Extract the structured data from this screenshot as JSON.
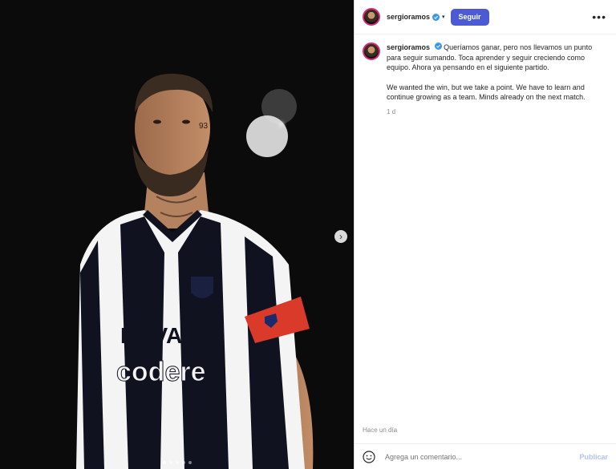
{
  "post": {
    "username": "sergioramos",
    "follow_label": "Seguir",
    "caption_es": "Queríamos ganar, pero nos llevamos un punto para seguir sumando. Toca aprender y seguir creciendo como equipo. Ahora ya pensando en el siguiente partido.",
    "caption_en": "We wanted the win, but we take a point. We have to learn and continue growing as a team. Minds already on the next match.",
    "caption_time": "1 d",
    "date_label": "Hace un día",
    "comment_placeholder": "Agrega un comentario...",
    "publish_label": "Publicar",
    "carousel": {
      "total": 5,
      "active": 1
    },
    "jersey_text": {
      "sponsor": "BBVA",
      "secondary": "codere"
    }
  },
  "colors": {
    "follow_button": "#4c5bd4",
    "verified": "#3897f0",
    "publish": "#b3c1f5"
  }
}
